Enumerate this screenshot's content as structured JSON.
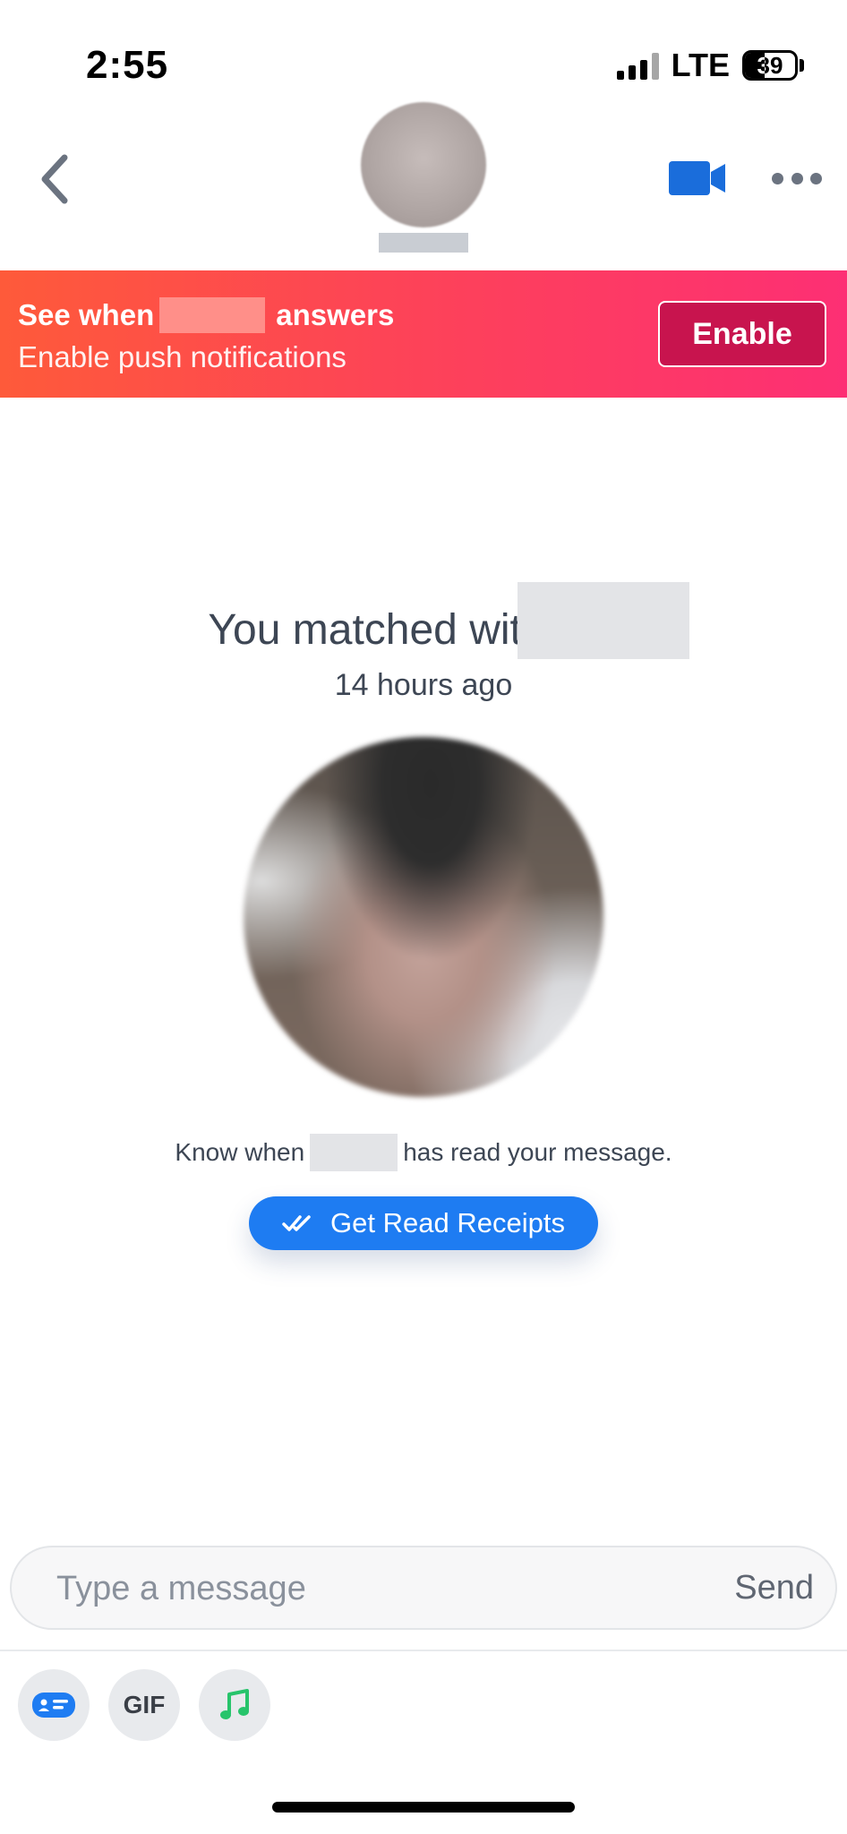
{
  "status_bar": {
    "time": "2:55",
    "network": "LTE",
    "battery": "39",
    "battery_level": 0.39
  },
  "header": {
    "back_icon": "chevron-left-icon",
    "video_icon": "video-camera-icon",
    "more_icon": "more-horizontal-icon",
    "accent_color": "#1a6ddb"
  },
  "banner": {
    "title_prefix": "See when",
    "title_suffix": "answers",
    "subtitle": "Enable push notifications",
    "enable_label": "Enable",
    "gradient": [
      "#fe5a3a",
      "#fd2f74"
    ]
  },
  "match": {
    "title": "You matched with",
    "time_ago": "14 hours ago",
    "read_prefix": "Know when",
    "read_suffix": "has read your message.",
    "receipts_label": "Get Read Receipts",
    "receipts_icon": "double-check-icon",
    "button_color": "#1e7cf2"
  },
  "composer": {
    "placeholder": "Type a message",
    "send_label": "Send"
  },
  "toolbar": {
    "gif_label": "GIF",
    "icons": [
      "message-card-icon",
      "gif-icon",
      "music-note-icon"
    ],
    "music_color": "#27c46b"
  }
}
